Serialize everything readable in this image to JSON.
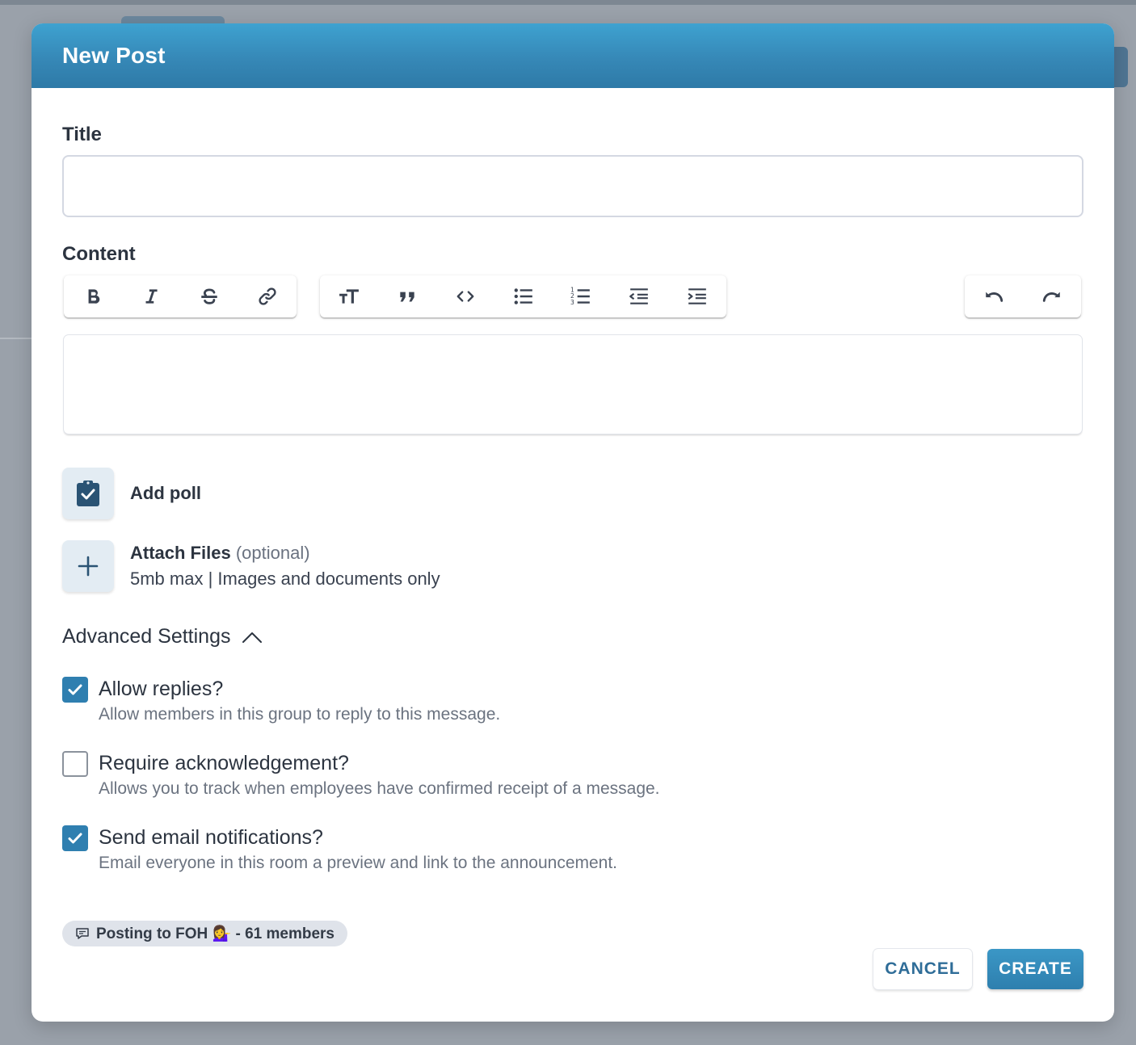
{
  "modal": {
    "title": "New Post"
  },
  "form": {
    "title_label": "Title",
    "title_value": "",
    "content_label": "Content",
    "content_value": ""
  },
  "toolbar": {
    "format_group": [
      "bold-icon",
      "italic-icon",
      "strikethrough-icon",
      "link-icon"
    ],
    "block_group": [
      "heading-icon",
      "quote-icon",
      "code-icon",
      "bullet-list-icon",
      "numbered-list-icon",
      "outdent-icon",
      "indent-icon"
    ],
    "history_group": [
      "undo-icon",
      "redo-icon"
    ]
  },
  "poll": {
    "label": "Add poll",
    "icon": "clipboard-check-icon"
  },
  "attach": {
    "label": "Attach Files",
    "optional": "(optional)",
    "hint": "5mb max | Images and documents only",
    "icon": "plus-icon"
  },
  "advanced": {
    "label": "Advanced Settings",
    "expanded": true,
    "options": [
      {
        "title": "Allow replies?",
        "description": "Allow members in this group to reply to this message.",
        "checked": true
      },
      {
        "title": "Require acknowledgement?",
        "description": "Allows you to track when employees have confirmed receipt of a message.",
        "checked": false
      },
      {
        "title": "Send email notifications?",
        "description": "Email everyone in this room a preview and link to the announcement.",
        "checked": true
      }
    ]
  },
  "footer": {
    "posting_to": "Posting to FOH 💁‍♀️ - 61 members",
    "cancel_label": "CANCEL",
    "create_label": "CREATE"
  },
  "colors": {
    "header": "#3688b7",
    "primary": "#2f7fb0",
    "icon_bg": "#e3ecf3"
  }
}
